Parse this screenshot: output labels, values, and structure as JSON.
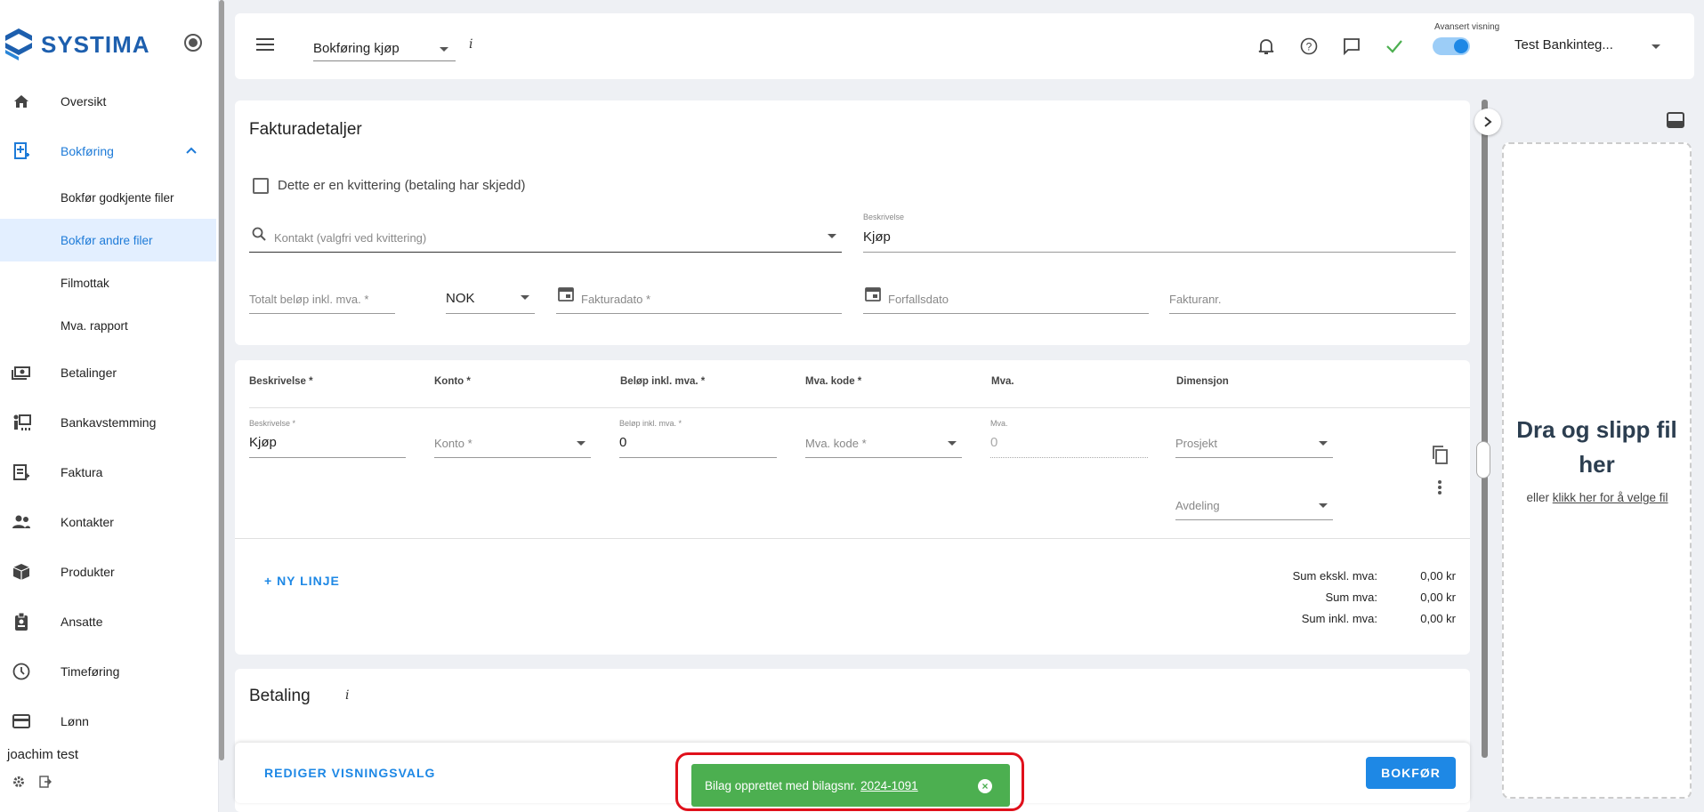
{
  "sidebar": {
    "brand": "SYSTIMA",
    "items": [
      {
        "label": "Oversikt",
        "icon": "home-icon"
      },
      {
        "label": "Bokføring",
        "icon": "book-add-icon"
      },
      {
        "label": "Betalinger",
        "icon": "money-icon"
      },
      {
        "label": "Bankavstemming",
        "icon": "bank-reconcile-icon"
      },
      {
        "label": "Faktura",
        "icon": "invoice-icon"
      },
      {
        "label": "Kontakter",
        "icon": "people-icon"
      },
      {
        "label": "Produkter",
        "icon": "box-icon"
      },
      {
        "label": "Ansatte",
        "icon": "badge-icon"
      },
      {
        "label": "Timeføring",
        "icon": "clock-icon"
      },
      {
        "label": "Lønn",
        "icon": "card-icon"
      }
    ],
    "subitems": [
      {
        "label": "Bokfør godkjente filer"
      },
      {
        "label": "Bokfør andre filer"
      },
      {
        "label": "Filmottak"
      },
      {
        "label": "Mva. rapport"
      }
    ],
    "user": "joachim test"
  },
  "topbar": {
    "mode": "Bokføring kjøp",
    "info": "i",
    "toggle_label": "Avansert visning",
    "toggle_on": true,
    "company": "Test Bankinteg..."
  },
  "invoice": {
    "title": "Fakturadetaljer",
    "receipt_checkbox": "Dette er en kvittering (betaling har skjedd)",
    "contact_placeholder": "Kontakt (valgfri ved kvittering)",
    "desc_label": "Beskrivelse",
    "desc_value": "Kjøp",
    "total_placeholder": "Totalt beløp inkl. mva. *",
    "currency": "NOK",
    "invoice_date_placeholder": "Fakturadato *",
    "due_date_placeholder": "Forfallsdato",
    "invoice_no_placeholder": "Fakturanr."
  },
  "lines": {
    "headers": [
      "Beskrivelse *",
      "Konto *",
      "Beløp inkl. mva. *",
      "Mva. kode *",
      "Mva.",
      "Dimensjon"
    ],
    "row": {
      "desc_label": "Beskrivelse *",
      "desc_value": "Kjøp",
      "konto_placeholder": "Konto *",
      "amount_label": "Beløp inkl. mva. *",
      "amount_value": "0",
      "mvakode_placeholder": "Mva. kode *",
      "mva_label": "Mva.",
      "mva_value": "0",
      "project_placeholder": "Prosjekt",
      "department_placeholder": "Avdeling"
    },
    "add_line": "+ NY LINJE",
    "sums": [
      {
        "label": "Sum ekskl. mva:",
        "value": "0,00 kr"
      },
      {
        "label": "Sum mva:",
        "value": "0,00 kr"
      },
      {
        "label": "Sum inkl. mva:",
        "value": "0,00 kr"
      }
    ]
  },
  "payment": {
    "title": "Betaling",
    "info": "i"
  },
  "footer": {
    "edit_view": "REDIGER VISNINGSVALG",
    "post": "BOKFØR"
  },
  "toast": {
    "text": "Bilag opprettet med bilagsnr.",
    "link": "2024-1091"
  },
  "dropzone": {
    "title": "Dra og slipp fil her",
    "sub_prefix": "eller",
    "sub_link": "klikk her for å velge fil"
  },
  "colors": {
    "accent": "#1e88e5",
    "success": "#4caf50",
    "highlight": "#e0101b"
  }
}
